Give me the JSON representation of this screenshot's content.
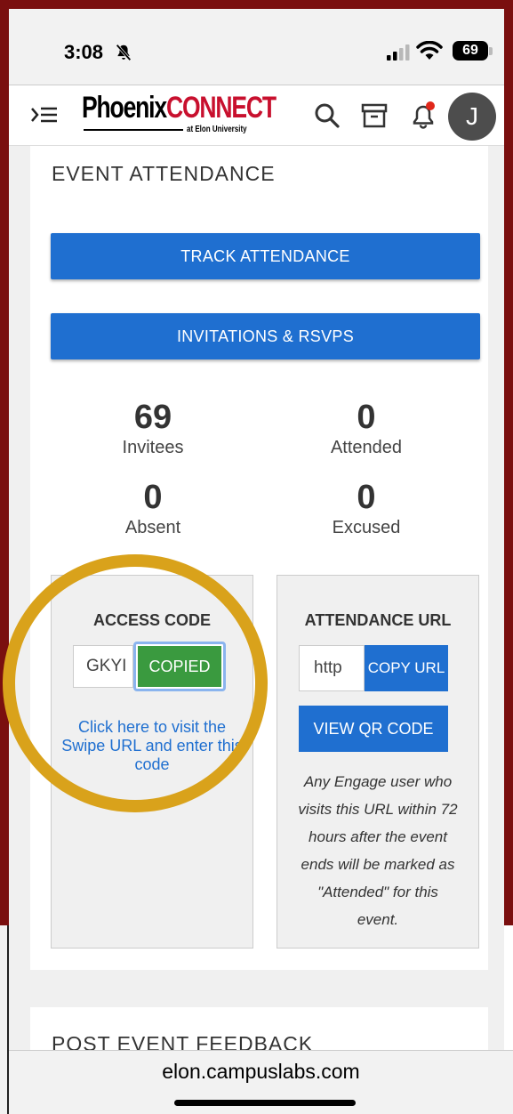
{
  "status_bar": {
    "time": "3:08",
    "battery": "69"
  },
  "header": {
    "logo_main_1": "Phoenix",
    "logo_main_2": "CONNECT",
    "logo_sub": "at Elon University",
    "avatar_initial": "J"
  },
  "event_attendance": {
    "title": "EVENT ATTENDANCE",
    "track_button": "TRACK ATTENDANCE",
    "invitations_button": "INVITATIONS & RSVPS",
    "stats": [
      {
        "value": "69",
        "label": "Invitees"
      },
      {
        "value": "0",
        "label": "Attended"
      },
      {
        "value": "0",
        "label": "Absent"
      },
      {
        "value": "0",
        "label": "Excused"
      }
    ],
    "access_code": {
      "title": "ACCESS CODE",
      "code_value": "GKYI",
      "copied_button": "COPIED",
      "link_text": "Click here to visit the Swipe URL and enter this code"
    },
    "attendance_url": {
      "title": "ATTENDANCE URL",
      "url_value": "http",
      "copy_button": "COPY URL",
      "qr_button": "VIEW QR CODE",
      "note": "Any Engage user who visits this URL within 72 hours after the event ends will be marked as \"Attended\" for this event."
    }
  },
  "post_event": {
    "title": "POST EVENT FEEDBACK"
  },
  "browser": {
    "url": "elon.campuslabs.com"
  },
  "colors": {
    "primary": "#1f6fd0",
    "success": "#3a9a3f",
    "highlight": "#d9a21b",
    "brand_red": "#c8102e",
    "frame": "#7a0f0f"
  }
}
